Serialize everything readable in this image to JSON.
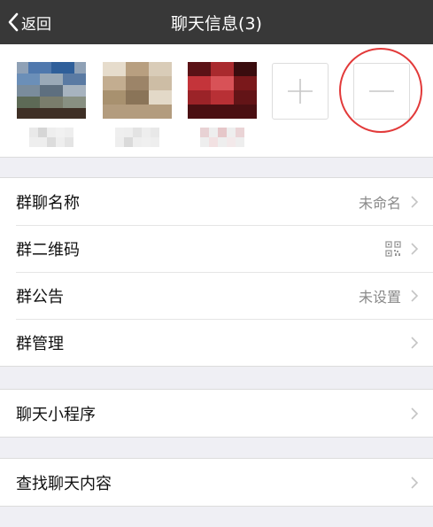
{
  "nav": {
    "back_label": "返回",
    "title": "聊天信息(3)"
  },
  "members": {
    "add_icon": "plus-icon",
    "remove_icon": "minus-icon"
  },
  "groups": [
    [
      {
        "label": "群聊名称",
        "value": "未命名"
      },
      {
        "label": "群二维码",
        "value": "",
        "icon": "qr-code-icon"
      },
      {
        "label": "群公告",
        "value": "未设置"
      },
      {
        "label": "群管理",
        "value": ""
      }
    ],
    [
      {
        "label": "聊天小程序",
        "value": ""
      }
    ],
    [
      {
        "label": "查找聊天内容",
        "value": ""
      }
    ]
  ],
  "colors": {
    "nav_bg": "#383838",
    "page_bg": "#efeff4",
    "highlight_circle": "#e23a3a"
  }
}
